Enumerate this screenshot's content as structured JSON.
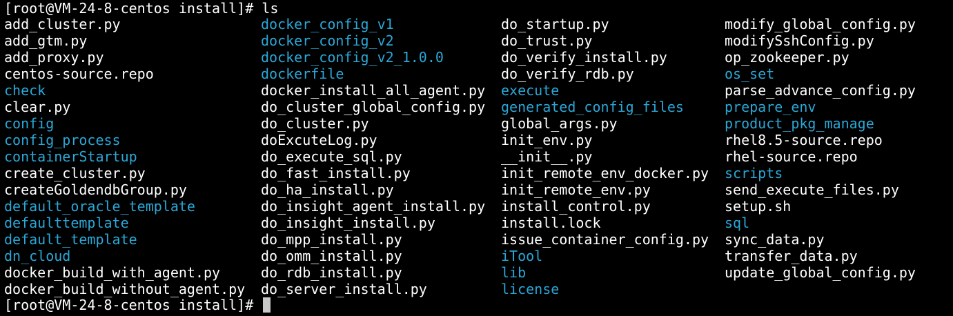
{
  "colors": {
    "background": "#000000",
    "text": "#ffffff",
    "directory": "#2aa8d8",
    "cursor": "#c8c8c8"
  },
  "prompt": "[root@VM-24-8-centos install]# ",
  "command": "ls",
  "columns": [
    [
      {
        "name": "add_cluster.py",
        "type": "file"
      },
      {
        "name": "add_gtm.py",
        "type": "file"
      },
      {
        "name": "add_proxy.py",
        "type": "file"
      },
      {
        "name": "centos-source.repo",
        "type": "file"
      },
      {
        "name": "check",
        "type": "dir"
      },
      {
        "name": "clear.py",
        "type": "file"
      },
      {
        "name": "config",
        "type": "dir"
      },
      {
        "name": "config_process",
        "type": "dir"
      },
      {
        "name": "containerStartup",
        "type": "dir"
      },
      {
        "name": "create_cluster.py",
        "type": "file"
      },
      {
        "name": "createGoldendbGroup.py",
        "type": "file"
      },
      {
        "name": "default_oracle_template",
        "type": "dir"
      },
      {
        "name": "defaulttemplate",
        "type": "dir"
      },
      {
        "name": "default_template",
        "type": "dir"
      },
      {
        "name": "dn_cloud",
        "type": "dir"
      },
      {
        "name": "docker_build_with_agent.py",
        "type": "file"
      },
      {
        "name": "docker_build_without_agent.py",
        "type": "file"
      }
    ],
    [
      {
        "name": "docker_config_v1",
        "type": "dir"
      },
      {
        "name": "docker_config_v2",
        "type": "dir"
      },
      {
        "name": "docker_config_v2_1.0.0",
        "type": "dir"
      },
      {
        "name": "dockerfile",
        "type": "dir"
      },
      {
        "name": "docker_install_all_agent.py",
        "type": "file"
      },
      {
        "name": "do_cluster_global_config.py",
        "type": "file"
      },
      {
        "name": "do_cluster.py",
        "type": "file"
      },
      {
        "name": "doExcuteLog.py",
        "type": "file"
      },
      {
        "name": "do_execute_sql.py",
        "type": "file"
      },
      {
        "name": "do_fast_install.py",
        "type": "file"
      },
      {
        "name": "do_ha_install.py",
        "type": "file"
      },
      {
        "name": "do_insight_agent_install.py",
        "type": "file"
      },
      {
        "name": "do_insight_install.py",
        "type": "file"
      },
      {
        "name": "do_mpp_install.py",
        "type": "file"
      },
      {
        "name": "do_omm_install.py",
        "type": "file"
      },
      {
        "name": "do_rdb_install.py",
        "type": "file"
      },
      {
        "name": "do_server_install.py",
        "type": "file"
      }
    ],
    [
      {
        "name": "do_startup.py",
        "type": "file"
      },
      {
        "name": "do_trust.py",
        "type": "file"
      },
      {
        "name": "do_verify_install.py",
        "type": "file"
      },
      {
        "name": "do_verify_rdb.py",
        "type": "file"
      },
      {
        "name": "execute",
        "type": "dir"
      },
      {
        "name": "generated_config_files",
        "type": "dir"
      },
      {
        "name": "global_args.py",
        "type": "file"
      },
      {
        "name": "init_env.py",
        "type": "file"
      },
      {
        "name": "__init__.py",
        "type": "file"
      },
      {
        "name": "init_remote_env_docker.py",
        "type": "file"
      },
      {
        "name": "init_remote_env.py",
        "type": "file"
      },
      {
        "name": "install_control.py",
        "type": "file"
      },
      {
        "name": "install.lock",
        "type": "file"
      },
      {
        "name": "issue_container_config.py",
        "type": "file"
      },
      {
        "name": "iTool",
        "type": "dir"
      },
      {
        "name": "lib",
        "type": "dir"
      },
      {
        "name": "license",
        "type": "dir"
      }
    ],
    [
      {
        "name": "modify_global_config.py",
        "type": "file"
      },
      {
        "name": "modifySshConfig.py",
        "type": "file"
      },
      {
        "name": "op_zookeeper.py",
        "type": "file"
      },
      {
        "name": "os_set",
        "type": "dir"
      },
      {
        "name": "parse_advance_config.py",
        "type": "file"
      },
      {
        "name": "prepare_env",
        "type": "dir"
      },
      {
        "name": "product_pkg_manage",
        "type": "dir"
      },
      {
        "name": "rhel8.5-source.repo",
        "type": "file"
      },
      {
        "name": "rhel-source.repo",
        "type": "file"
      },
      {
        "name": "scripts",
        "type": "dir"
      },
      {
        "name": "send_execute_files.py",
        "type": "file"
      },
      {
        "name": "setup.sh",
        "type": "file"
      },
      {
        "name": "sql",
        "type": "dir"
      },
      {
        "name": "sync_data.py",
        "type": "file"
      },
      {
        "name": "transfer_data.py",
        "type": "file"
      },
      {
        "name": "update_global_config.py",
        "type": "file"
      }
    ]
  ]
}
